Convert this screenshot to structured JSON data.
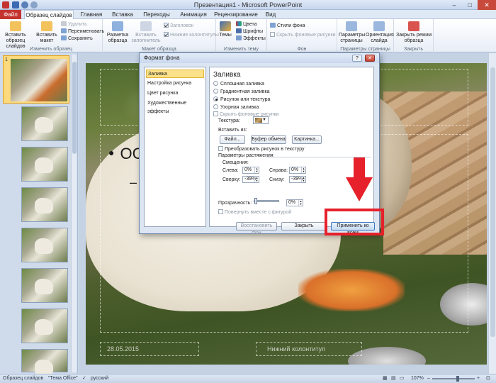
{
  "window": {
    "title": "Презентация1 - Microsoft PowerPoint",
    "minimize": "–",
    "maximize": "□",
    "close": "✕"
  },
  "ribbon_tabs": [
    {
      "label": "Файл"
    },
    {
      "label": "Образец слайдов"
    },
    {
      "label": "Главная"
    },
    {
      "label": "Вставка"
    },
    {
      "label": "Переходы"
    },
    {
      "label": "Анимация"
    },
    {
      "label": "Рецензирование"
    },
    {
      "label": "Вид"
    }
  ],
  "ribbon": {
    "edit_master": {
      "label": "Изменить образец",
      "insert_master": "Вставить образец слайдов",
      "insert_layout": "Вставить макет",
      "delete": "Удалить",
      "rename": "Переименовать",
      "preserve": "Сохранить"
    },
    "master_layout": {
      "label": "Макет образца",
      "master_layout_btn": "Разметка образца",
      "insert_placeholder": "Вставить заполнитель",
      "title_cb": "Заголовок",
      "footers_cb": "Нижние колонтитулы"
    },
    "edit_theme": {
      "label": "Изменить тему",
      "themes": "Темы",
      "colors": "Цвета",
      "fonts": "Шрифты",
      "effects": "Эффекты"
    },
    "background": {
      "label": "Фон",
      "bg_styles": "Стили фона",
      "hide_bg": "Скрыть фоновые рисунки"
    },
    "page_setup": {
      "label": "Параметры страницы",
      "page_setup_btn": "Параметры страницы",
      "orientation": "Ориентация слайда"
    },
    "close": {
      "label": "Закрыть",
      "close_master": "Закрыть режим образца"
    }
  },
  "slide_pane": {
    "first_number": "1"
  },
  "slide": {
    "bullet": "ОС",
    "dash": "–",
    "date": "28.05.2015",
    "footer": "Нижний колонтитул"
  },
  "statusbar": {
    "view": "Образец слайдов",
    "theme": "\"Тема Office\"",
    "language": "русский",
    "zoom": "107%"
  },
  "dialog": {
    "title": "Формат фона",
    "help": "?",
    "close": "✕",
    "nav": [
      {
        "label": "Заливка"
      },
      {
        "label": "Настройка рисунка"
      },
      {
        "label": "Цвет рисунка"
      },
      {
        "label": "Художественные эффекты"
      }
    ],
    "heading": "Заливка",
    "fill_options": [
      {
        "label": "Сплошная заливка"
      },
      {
        "label": "Градиентная заливка"
      },
      {
        "label": "Рисунок или текстура"
      },
      {
        "label": "Узорная заливка"
      }
    ],
    "hide_bg": "Скрыть фоновые рисунки",
    "texture_label": "Текстура:",
    "insert_from": "Вставить из:",
    "file_btn": "Файл...",
    "clipboard_btn": "Буфер обмена",
    "clip_btn": "Картинка...",
    "tile_cb": "Преобразовать рисунок в текстуру",
    "stretch_label": "Параметры растяжения",
    "offsets_label": "Смещения:",
    "left": {
      "label": "Слева:",
      "value": "0%"
    },
    "right": {
      "label": "Справа:",
      "value": "0%"
    },
    "top": {
      "label": "Сверху:",
      "value": "-39%"
    },
    "bottom": {
      "label": "Снизу:",
      "value": "-39%"
    },
    "transparency": {
      "label": "Прозрачность:",
      "value": "0%"
    },
    "rotate_cb": "Повернуть вместе с фигурой",
    "reset_btn": "Восстановить фон",
    "close_btn": "Закрыть",
    "apply_all_btn": "Применить ко всем"
  },
  "colors": {
    "file_tab": "#c4342f",
    "highlight": "#e6212b",
    "nav_selected": "#fbe28a"
  }
}
